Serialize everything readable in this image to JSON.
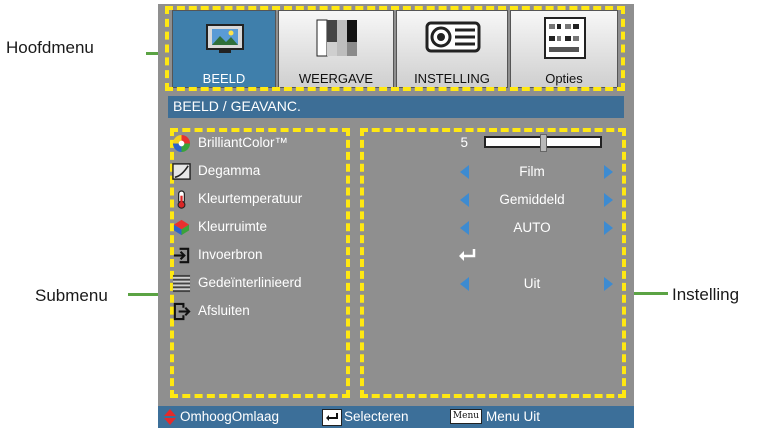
{
  "callouts": {
    "main_menu": "Hoofdmenu",
    "submenu": "Submenu",
    "setting": "Instelling"
  },
  "tabs": [
    {
      "label": "BEELD",
      "icon": "picture-icon",
      "active": true
    },
    {
      "label": "WEERGAVE",
      "icon": "display-bars-icon",
      "active": false
    },
    {
      "label": "INSTELLING",
      "icon": "projector-icon",
      "active": false
    },
    {
      "label": "Opties",
      "icon": "options-grid-icon",
      "active": false
    }
  ],
  "section_title": "BEELD / GEAVANC.",
  "menu_items": [
    {
      "label": "BrilliantColor™",
      "icon": "color-wheel-icon"
    },
    {
      "label": "Degamma",
      "icon": "gamma-curve-icon"
    },
    {
      "label": "Kleurtemperatuur",
      "icon": "thermometer-icon"
    },
    {
      "label": "Kleurruimte",
      "icon": "color-space-icon"
    },
    {
      "label": "Invoerbron",
      "icon": "input-source-icon"
    },
    {
      "label": "Gedeïnterlinieerd",
      "icon": "deinterlace-icon"
    },
    {
      "label": "Afsluiten",
      "icon": "exit-icon"
    }
  ],
  "settings": {
    "brilliantcolor_value": "5",
    "brilliantcolor_level": 0.5,
    "degamma": "Film",
    "color_temperature": "Gemiddeld",
    "color_space": "AUTO",
    "deinterlace": "Uit"
  },
  "footer": {
    "updown": "OmhoogOmlaag",
    "select": "Selecteren",
    "menu_key": "Menu",
    "menu_exit": "Menu Uit"
  },
  "colors": {
    "highlight_border": "#ffe812",
    "active_tab": "#3f7fab",
    "title_bar": "#3d6e96",
    "osd_background": "#8f8f8f",
    "arrow": "#3d8bd1",
    "callout_line": "#5ba344"
  }
}
